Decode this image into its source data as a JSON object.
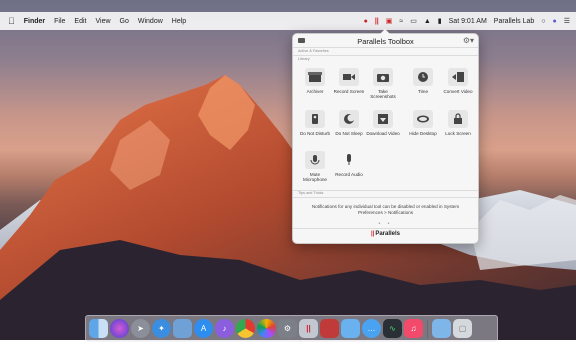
{
  "menubar": {
    "apple_label": "",
    "items": [
      "Finder",
      "File",
      "Edit",
      "View",
      "Go",
      "Window",
      "Help"
    ],
    "clock": "Sat 9:01 AM",
    "user": "Parallels Lab"
  },
  "toolbox": {
    "title": "Parallels Toolbox",
    "section_favorites": "Active & Favorites",
    "section_library": "Library",
    "section_tips": "Tips and Tricks",
    "tools": [
      {
        "label": "Archiver",
        "icon": "archive-icon"
      },
      {
        "label": "Record Screen",
        "icon": "video-camera-icon"
      },
      {
        "label": "Take Screenshots",
        "icon": "camera-icon"
      },
      {
        "label": "Time",
        "icon": "clock-icon"
      },
      {
        "label": "Convert Video",
        "icon": "convert-video-icon"
      },
      {
        "label": "Do Not Disturb",
        "icon": "do-not-disturb-icon"
      },
      {
        "label": "Do Not Sleep",
        "icon": "do-not-sleep-icon"
      },
      {
        "label": "Download Video",
        "icon": "download-video-icon"
      },
      {
        "label": "Hide Desktop",
        "icon": "hide-desktop-icon"
      },
      {
        "label": "Lock Screen",
        "icon": "lock-icon"
      },
      {
        "label": "Mute Microphone",
        "icon": "mute-microphone-icon"
      },
      {
        "label": "Record Audio",
        "icon": "microphone-icon"
      }
    ],
    "tip": "Notifications for any individual tool can be disabled or enabled in System Preferences > Notifications",
    "pager": "• •",
    "brand": "Parallels",
    "brand_bars": "||"
  },
  "dock": {
    "icons": [
      "finder-icon",
      "siri-icon",
      "launchpad-icon",
      "safari-icon",
      "photos-preview-icon",
      "app-store-icon",
      "itunes-circle-icon",
      "chrome-icon",
      "photos-icon",
      "system-preferences-icon",
      "parallels-toolbox-icon",
      "screenshot-icon",
      "folder-icon",
      "messages-icon",
      "activity-monitor-icon",
      "music-icon",
      "downloads-folder-icon",
      "trash-icon"
    ]
  }
}
